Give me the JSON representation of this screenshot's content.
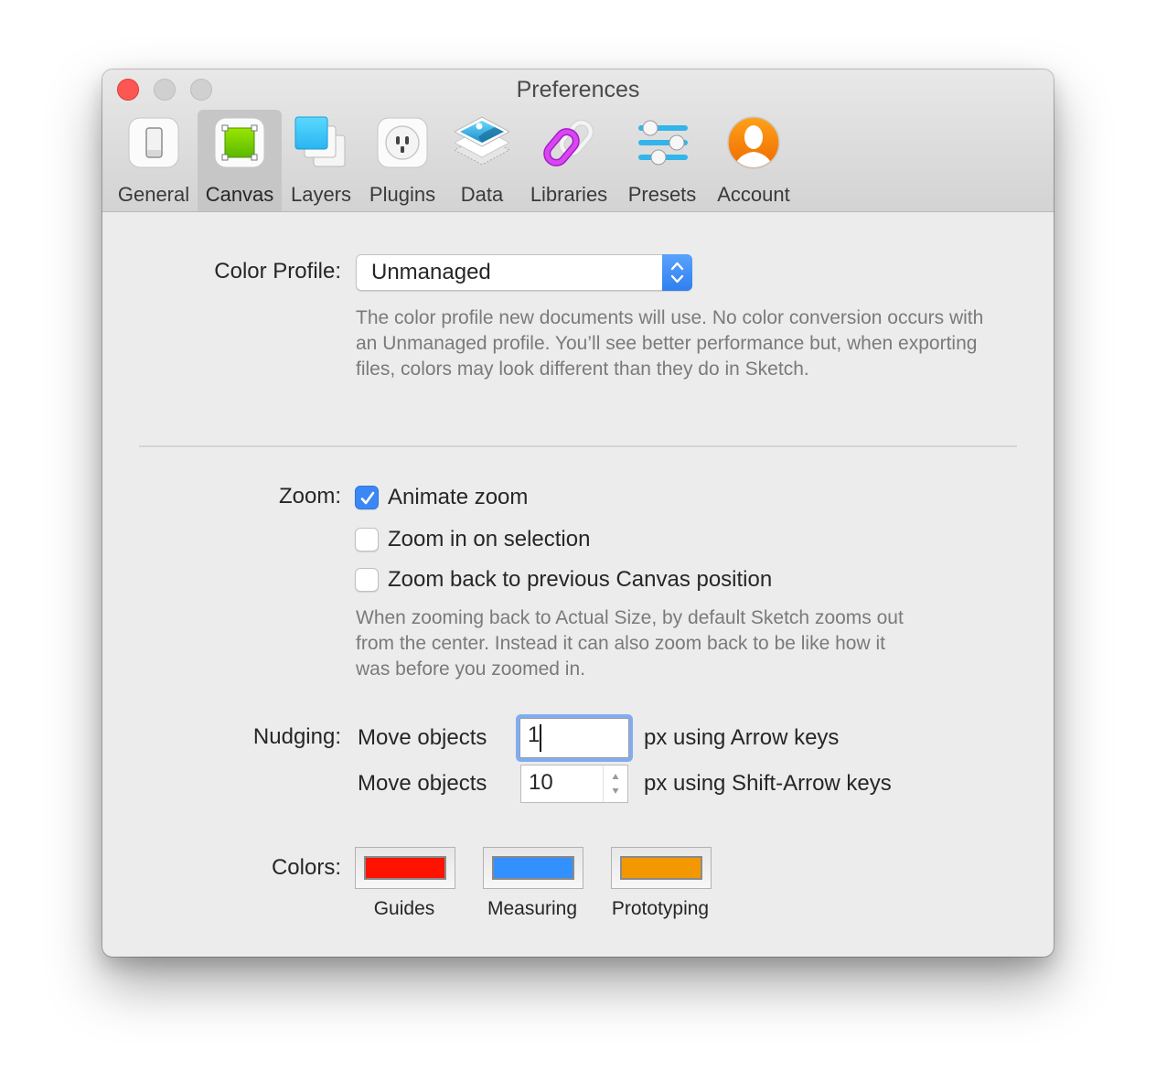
{
  "window": {
    "title": "Preferences",
    "traffic_lights": [
      "close",
      "minimize",
      "zoom"
    ]
  },
  "toolbar": {
    "selected": "Canvas",
    "items": [
      {
        "label": "General",
        "icon": "switch-icon"
      },
      {
        "label": "Canvas",
        "icon": "canvas-artboard-icon"
      },
      {
        "label": "Layers",
        "icon": "layers-icon"
      },
      {
        "label": "Plugins",
        "icon": "plug-socket-icon"
      },
      {
        "label": "Data",
        "icon": "data-image-stack-icon"
      },
      {
        "label": "Libraries",
        "icon": "link-chain-icon"
      },
      {
        "label": "Presets",
        "icon": "sliders-icon"
      },
      {
        "label": "Account",
        "icon": "user-avatar-icon"
      }
    ]
  },
  "color_profile": {
    "label": "Color Profile:",
    "value": "Unmanaged",
    "help": "The color profile new documents will use. No color conversion occurs with an Unmanaged profile. You’ll see better performance but, when exporting files, colors may look different than they do in Sketch."
  },
  "zoom": {
    "label": "Zoom:",
    "options": [
      {
        "label": "Animate zoom",
        "checked": true
      },
      {
        "label": "Zoom in on selection",
        "checked": false
      },
      {
        "label": "Zoom back to previous Canvas position",
        "checked": false
      }
    ],
    "help": "When zooming back to Actual Size, by default Sketch zooms out from the center. Instead it can also zoom back to be like how it was before you zoomed in."
  },
  "nudging": {
    "label": "Nudging:",
    "rows": [
      {
        "prefix": "Move objects",
        "value": "1",
        "suffix": "px using Arrow keys"
      },
      {
        "prefix": "Move objects",
        "value": "10",
        "suffix": "px using Shift-Arrow keys"
      }
    ]
  },
  "colors": {
    "label": "Colors:",
    "wells": [
      {
        "label": "Guides",
        "color": "#ff1300"
      },
      {
        "label": "Measuring",
        "color": "#3391ff"
      },
      {
        "label": "Prototyping",
        "color": "#f39800"
      }
    ]
  }
}
